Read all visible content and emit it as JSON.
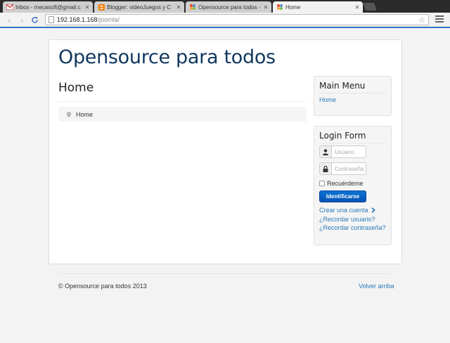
{
  "browser": {
    "tabs": [
      {
        "title": "Inbox - mecasoft@gmail.c",
        "icon": "gmail-icon",
        "active": false
      },
      {
        "title": "Blogger: videoJuegos y C",
        "icon": "blogger-icon",
        "active": false
      },
      {
        "title": "Opensource para todos -",
        "icon": "joomla-icon",
        "active": false
      },
      {
        "title": "Home",
        "icon": "joomla-icon",
        "active": true
      }
    ],
    "url_host": "192.168.1.168",
    "url_path": "/joomla/"
  },
  "site": {
    "title": "Opensource para todos"
  },
  "main": {
    "heading": "Home",
    "breadcrumb": "Home"
  },
  "sidebar": {
    "main_menu": {
      "title": "Main Menu",
      "items": [
        "Home"
      ]
    },
    "login_form": {
      "title": "Login Form",
      "username_placeholder": "Usuario",
      "password_placeholder": "Contraseña",
      "remember_label": "Recuérdeme",
      "submit_label": "Identificarse",
      "links": [
        "Crear una cuenta",
        "¿Recordar usuario?",
        "¿Recordar contraseña?"
      ]
    }
  },
  "footer": {
    "copyright": "© Opensource para todos 2013",
    "back_to_top": "Volver arriba"
  },
  "colors": {
    "title": "#10375e",
    "link": "#2a7ab9",
    "button": "#0553b3",
    "address_bar_accent": "#2b78c8"
  }
}
